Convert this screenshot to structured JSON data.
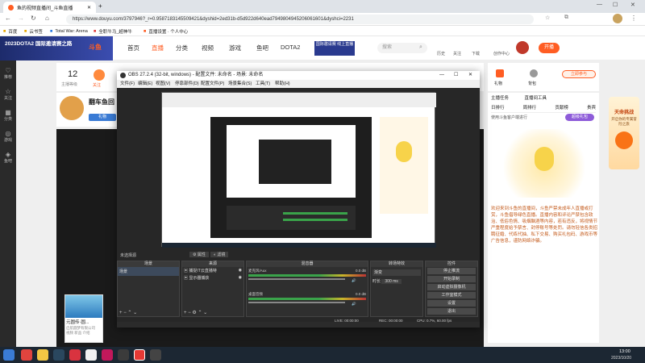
{
  "browser": {
    "tab_title": "鱼的视频直播间_斗鱼直播",
    "url": "https://www.douyu.com/3797946?_r=0.9587183145509421&dyshid=2ed31b-d5d922d640ead7949804945206061601&dyshci=2231",
    "bookmarks": [
      "百度",
      "云书签",
      "Total War: Arena",
      "全职牛马_超神牛",
      "直播设置 · 个人中心"
    ]
  },
  "douyu": {
    "logo": "斗鱼",
    "banner_text": "2023DOTA2 国际邀请赛之路",
    "nav": [
      "首页",
      "直播",
      "分类",
      "视频",
      "游戏",
      "鱼吧",
      "DOTA2"
    ],
    "active_nav": "直播",
    "promo_label": "国际邀请赛 线上直播",
    "search_placeholder": "搜索",
    "header_icons": [
      "历史",
      "关注",
      "下载",
      "创作中心"
    ],
    "open_live_button": "开播",
    "left_rail": [
      "推荐",
      "关注",
      "分类",
      "游戏",
      "鱼吧"
    ],
    "room": {
      "count": "12",
      "count_label": "主播等级",
      "fans_label": "关注",
      "title": "翻车鱼回",
      "gift_button": "礼物"
    },
    "right_icons": [
      "礼物",
      "背包"
    ],
    "right_panel": {
      "tabs": [
        "主播任务",
        "直播间工具"
      ],
      "sub_tabs": [
        "日排行",
        "周排行",
        "贡献榜",
        "贵宾"
      ],
      "hint": "使用斗鱼客户端进行",
      "promo_button": "超级礼包",
      "chat": "欢迎来到斗鱼的直播间，斗鱼严禁未成年人直播或打赏，斗鱼倡导绿色直播。直播内容和评论严禁包含政治、低俗色情、吸烟酗酒等内容，若有违反，将视情节严重程度给予禁言、封停账号等处罚。请勿轻信各类招聘征婚、代练代抽、私下交易、购买礼包码、游戏币等广告信息，谨防网络诈骗。"
    },
    "side_promo": {
      "title": "天命挑战",
      "line": "开启你的专属冒险之旅",
      "button": "立即参与"
    },
    "ad_card": {
      "title": "元圆传·圆...",
      "line1": "启航圆梦有限公司",
      "line2": "视频 新品 介绍"
    }
  },
  "obs": {
    "title": "OBS 27.2.4 (32-bit, windows) - 配置文件: 未命名 - 场景: 未命名",
    "menu": [
      "文件(F)",
      "编辑(E)",
      "视图(V)",
      "停靠部件(D)",
      "配置文件(P)",
      "场景集合(S)",
      "工具(T)",
      "帮助(H)"
    ],
    "no_source": "未选择源",
    "prop_buttons": [
      "属性",
      "滤镜"
    ],
    "docks": {
      "scenes_title": "场景",
      "scenes": [
        "场景"
      ],
      "sources_title": "来源",
      "sources": [
        "捕捉IT云直播特",
        "显示器捕获"
      ],
      "mixer_title": "混音器",
      "mixer": [
        {
          "name": "麦克风/Aux",
          "level": "0.0 dB"
        },
        {
          "name": "桌面音频",
          "level": "0.0 dB"
        }
      ],
      "transitions_title": "转场特效",
      "transition": "渐变",
      "duration_label": "时长",
      "duration": "300 ms",
      "controls_title": "控件",
      "controls": [
        "停止推流",
        "开始录制",
        "启动虚拟摄像机",
        "工作室模式",
        "设置",
        "退出"
      ]
    },
    "status": {
      "live": "LIVE: 00:00:00",
      "rec": "REC: 00:00:00",
      "cpu": "CPU: 0.7%, 60.00 fps"
    }
  },
  "taskbar": {
    "time": "13:00",
    "date": "2023/10/20"
  },
  "colors": {
    "douyu_orange": "#ff5d23",
    "obs_dark": "#2b2b2b",
    "taskbar": "#1c2733"
  }
}
